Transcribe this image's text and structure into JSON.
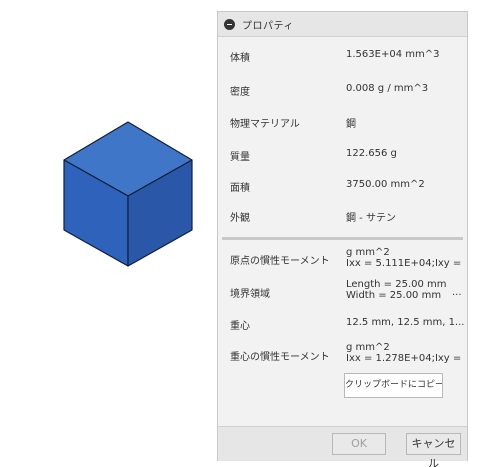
{
  "panel": {
    "title": "プロパティ"
  },
  "properties": {
    "volume": {
      "label": "体積",
      "value": "1.563E+04 mm^3"
    },
    "density": {
      "label": "密度",
      "value": "0.008 g / mm^3"
    },
    "material": {
      "label": "物理マテリアル",
      "value": "鋼"
    },
    "mass": {
      "label": "質量",
      "value": "122.656 g"
    },
    "area": {
      "label": "面積",
      "value": "3750.00 mm^2"
    },
    "appearance": {
      "label": "外観",
      "value": "鋼 - サテン"
    }
  },
  "advanced": {
    "origin_inertia": {
      "label": "原点の慣性モーメント",
      "line1": "g mm^2",
      "line2": "Ixx = 5.111E+04;Ixy = ..."
    },
    "bounding_box": {
      "label": "境界領域",
      "line1": "Length = 25.00 mm",
      "line2": "Width = 25.00 mm",
      "more": "···"
    },
    "center_of_mass": {
      "label": "重心",
      "value": "12.5 mm, 12.5 mm, 1..."
    },
    "com_inertia": {
      "label": "重心の慣性モーメント",
      "line1": "g mm^2",
      "line2": "Ixx = 1.278E+04;Ixy = ..."
    }
  },
  "buttons": {
    "copy": "クリップボードにコピー",
    "ok": "OK",
    "cancel": "キャンセル"
  },
  "colors": {
    "cube_top": "#3f76c8",
    "cube_left": "#2f62ba",
    "cube_right": "#2a57a8",
    "ok_disabled_text": "#a0a0a0"
  },
  "icons": {
    "collapse": "minus-circle-icon"
  }
}
